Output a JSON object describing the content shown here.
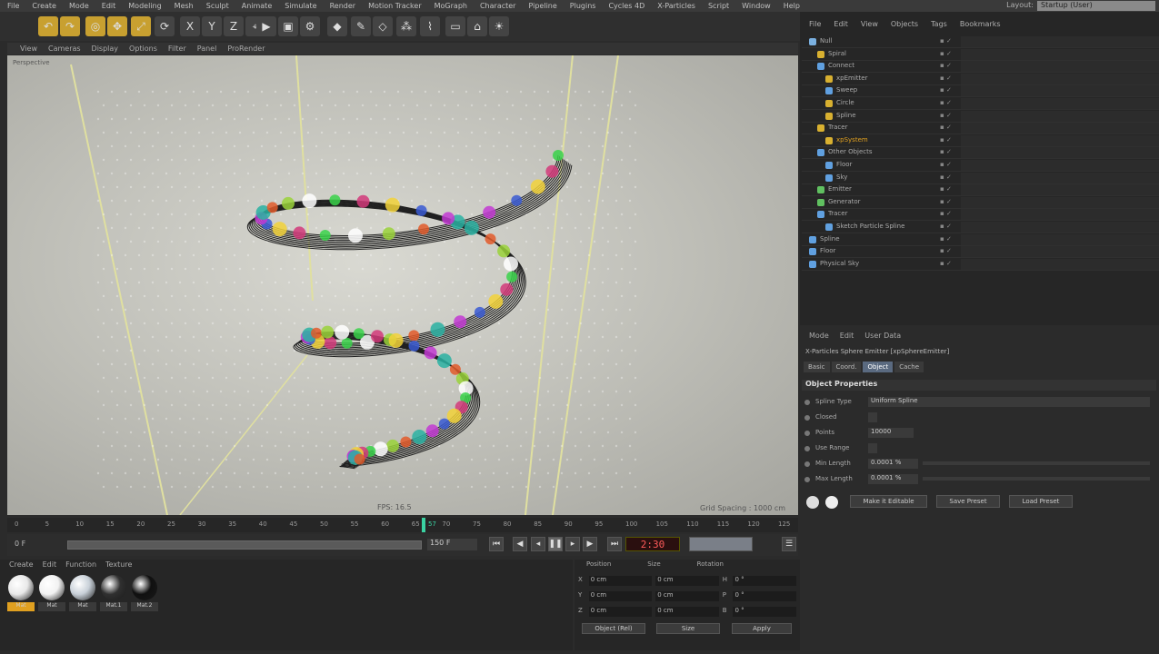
{
  "menubar": {
    "items": [
      "File",
      "Create",
      "Mode",
      "Edit",
      "Modeling",
      "Mesh",
      "Sculpt",
      "Animate",
      "Simulate",
      "Render",
      "Motion Tracker",
      "MoGraph",
      "Character",
      "Pipeline",
      "Plugins",
      "Cycles 4D",
      "X-Particles",
      "Script",
      "Window",
      "Help"
    ],
    "layout_label": "Layout:",
    "layout_value": "Startup (User)"
  },
  "toolbar": {
    "icons": [
      "undo-icon",
      "redo-icon",
      "live-select-icon",
      "move-icon",
      "scale-icon",
      "rotate-icon",
      "x-axis-icon",
      "y-axis-icon",
      "z-axis-icon",
      "world-coords-icon",
      "render-view-icon",
      "render-picture-viewer-icon",
      "render-settings-icon",
      "cube-icon",
      "pen-icon",
      "subdivision-icon",
      "cloner-icon",
      "deformer-icon",
      "floor-icon",
      "camera-icon",
      "light-icon"
    ]
  },
  "viewport": {
    "menu": [
      "View",
      "Cameras",
      "Display",
      "Options",
      "Filter",
      "Panel",
      "ProRender"
    ],
    "perspective_label": "Perspective",
    "fps": "FPS: 16.5",
    "grid_spacing": "Grid Spacing : 1000 cm"
  },
  "timeline": {
    "ticks": [
      "0",
      "5",
      "10",
      "15",
      "20",
      "25",
      "30",
      "35",
      "40",
      "45",
      "50",
      "55",
      "60",
      "65",
      "70",
      "75",
      "80",
      "85",
      "90",
      "95",
      "100",
      "105",
      "110",
      "115",
      "120",
      "125"
    ],
    "playhead_frame": "57",
    "start_field": "0 F",
    "end_field": "150 F",
    "current_frame": "2:30"
  },
  "materials": {
    "menu": [
      "Create",
      "Edit",
      "Function",
      "Texture"
    ],
    "items": [
      {
        "label": "Mat",
        "color": "#e8e8e8"
      },
      {
        "label": "Mat",
        "color": "#f2f2f2"
      },
      {
        "label": "Mat",
        "color": "#c8d0d8"
      },
      {
        "label": "Mat.1",
        "color": "#303030"
      },
      {
        "label": "Mat.2",
        "color": "#101010"
      }
    ]
  },
  "coordinates": {
    "headers": [
      "Position",
      "Size",
      "Rotation"
    ],
    "rows": [
      {
        "axis": "X",
        "pos": "0 cm",
        "size": "0 cm",
        "rot_axis": "H",
        "rot": "0 °"
      },
      {
        "axis": "Y",
        "pos": "0 cm",
        "size": "0 cm",
        "rot_axis": "P",
        "rot": "0 °"
      },
      {
        "axis": "Z",
        "pos": "0 cm",
        "size": "0 cm",
        "rot_axis": "B",
        "rot": "0 °"
      }
    ],
    "mode": "Object (Rel)",
    "size_mode": "Size",
    "apply": "Apply"
  },
  "objects": {
    "menu": [
      "File",
      "Edit",
      "View",
      "Objects",
      "Tags",
      "Bookmarks"
    ],
    "rows": [
      {
        "name": "Null",
        "indent": 0,
        "icon": "#7ab0e0"
      },
      {
        "name": "Spiral",
        "indent": 1,
        "icon": "#d8b030"
      },
      {
        "name": "Connect",
        "indent": 1,
        "icon": "#60a0e0"
      },
      {
        "name": "xpEmitter",
        "indent": 2,
        "icon": "#d8b030"
      },
      {
        "name": "Sweep",
        "indent": 2,
        "icon": "#60a0e0"
      },
      {
        "name": "Circle",
        "indent": 2,
        "icon": "#d8b030"
      },
      {
        "name": "Spline",
        "indent": 2,
        "icon": "#d8b030"
      },
      {
        "name": "Tracer",
        "indent": 1,
        "icon": "#d8b030"
      },
      {
        "name": "xpSystem",
        "indent": 2,
        "icon": "#d8b030"
      },
      {
        "name": "Other Objects",
        "indent": 1,
        "icon": "#60a0e0"
      },
      {
        "name": "Floor",
        "indent": 2,
        "icon": "#60a0e0"
      },
      {
        "name": "Sky",
        "indent": 2,
        "icon": "#60a0e0"
      },
      {
        "name": "Emitter",
        "indent": 1,
        "icon": "#60c060"
      },
      {
        "name": "Generator",
        "indent": 1,
        "icon": "#60c060"
      },
      {
        "name": "Tracer",
        "indent": 1,
        "icon": "#60a0e0"
      },
      {
        "name": "Sketch Particle Spline",
        "indent": 2,
        "icon": "#60a0e0"
      },
      {
        "name": "Spline",
        "indent": 0,
        "icon": "#60a0e0"
      },
      {
        "name": "Floor",
        "indent": 0,
        "icon": "#60a0e0"
      },
      {
        "name": "Physical Sky",
        "indent": 0,
        "icon": "#60a0e0"
      }
    ]
  },
  "attributes": {
    "menu": [
      "Mode",
      "Edit",
      "User Data"
    ],
    "title": "X-Particles Sphere Emitter [xpSphereEmitter]",
    "tabs": [
      "Basic",
      "Coord.",
      "Object",
      "Cache"
    ],
    "active_tab": "Object",
    "section": "Object Properties",
    "props": [
      {
        "label": "Spline Type",
        "value": "Uniform Spline"
      },
      {
        "label": "Closed",
        "value": ""
      },
      {
        "label": "Points",
        "value": "10000"
      },
      {
        "label": "Use Range",
        "value": ""
      },
      {
        "label": "Min Length",
        "value": "0.0001 %"
      },
      {
        "label": "Max Length",
        "value": "0.0001 %"
      }
    ],
    "buttons": [
      "Make it Editable",
      "Save Preset",
      "Load Preset"
    ]
  }
}
